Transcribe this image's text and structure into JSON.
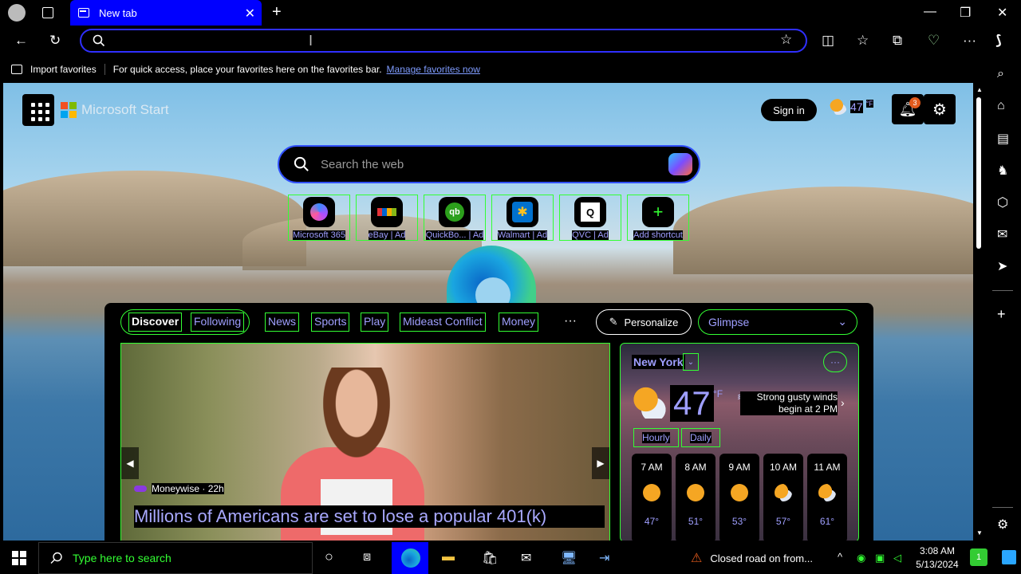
{
  "browser": {
    "tab_title": "New tab",
    "tab_close": "✕",
    "new_tab": "+",
    "win_min": "—",
    "win_restore": "❐",
    "win_close": "✕"
  },
  "favorites_bar": {
    "import_label": "Import favorites",
    "hint": "For quick access, place your favorites here on the favorites bar.",
    "manage_link": "Manage favorites now"
  },
  "start": {
    "brand": "Microsoft Start",
    "sign_in": "Sign in",
    "weather_temp": "47",
    "weather_unit": "°F",
    "notification_count": "3",
    "search_placeholder": "Search the web",
    "shortcuts": [
      {
        "label": "Microsoft 365",
        "icon": "microsoft-365-icon"
      },
      {
        "label": "eBay | Ad",
        "icon": "ebay-icon"
      },
      {
        "label": "QuickBo... | Ad",
        "icon": "quickbooks-icon"
      },
      {
        "label": "Walmart | Ad",
        "icon": "walmart-icon"
      },
      {
        "label": "QVC | Ad",
        "icon": "qvc-icon"
      },
      {
        "label": "Add shortcut",
        "icon": "plus-icon"
      }
    ]
  },
  "feed": {
    "tabs": [
      "Discover",
      "Following",
      "News",
      "Sports",
      "Play",
      "Mideast Conflict",
      "Money"
    ],
    "more": "···",
    "personalize": "Personalize",
    "glimpse": "Glimpse",
    "hero": {
      "source": "Moneywise · 22h",
      "headline": "Millions of Americans are set to lose a popular 401(k)"
    },
    "weather": {
      "city": "New York",
      "temp": "47",
      "unit": "°F",
      "alert": "Strong gusty winds begin at 2 PM",
      "tabs": [
        "Hourly",
        "Daily"
      ],
      "hours": [
        {
          "time": "7 AM",
          "temp": "47°",
          "icon": "sunny"
        },
        {
          "time": "8 AM",
          "temp": "51°",
          "icon": "sunny"
        },
        {
          "time": "9 AM",
          "temp": "53°",
          "icon": "sunny"
        },
        {
          "time": "10 AM",
          "temp": "57°",
          "icon": "partly-cloudy"
        },
        {
          "time": "11 AM",
          "temp": "61°",
          "icon": "partly-cloudy"
        }
      ]
    }
  },
  "taskbar": {
    "search_placeholder": "Type here to search",
    "news_ticker": "Closed road on from...",
    "time": "3:08 AM",
    "date": "5/13/2024",
    "notify_count": "1"
  },
  "colors": {
    "accent": "#0000ff",
    "outline": "#33ff33",
    "link": "#9f9fff"
  }
}
